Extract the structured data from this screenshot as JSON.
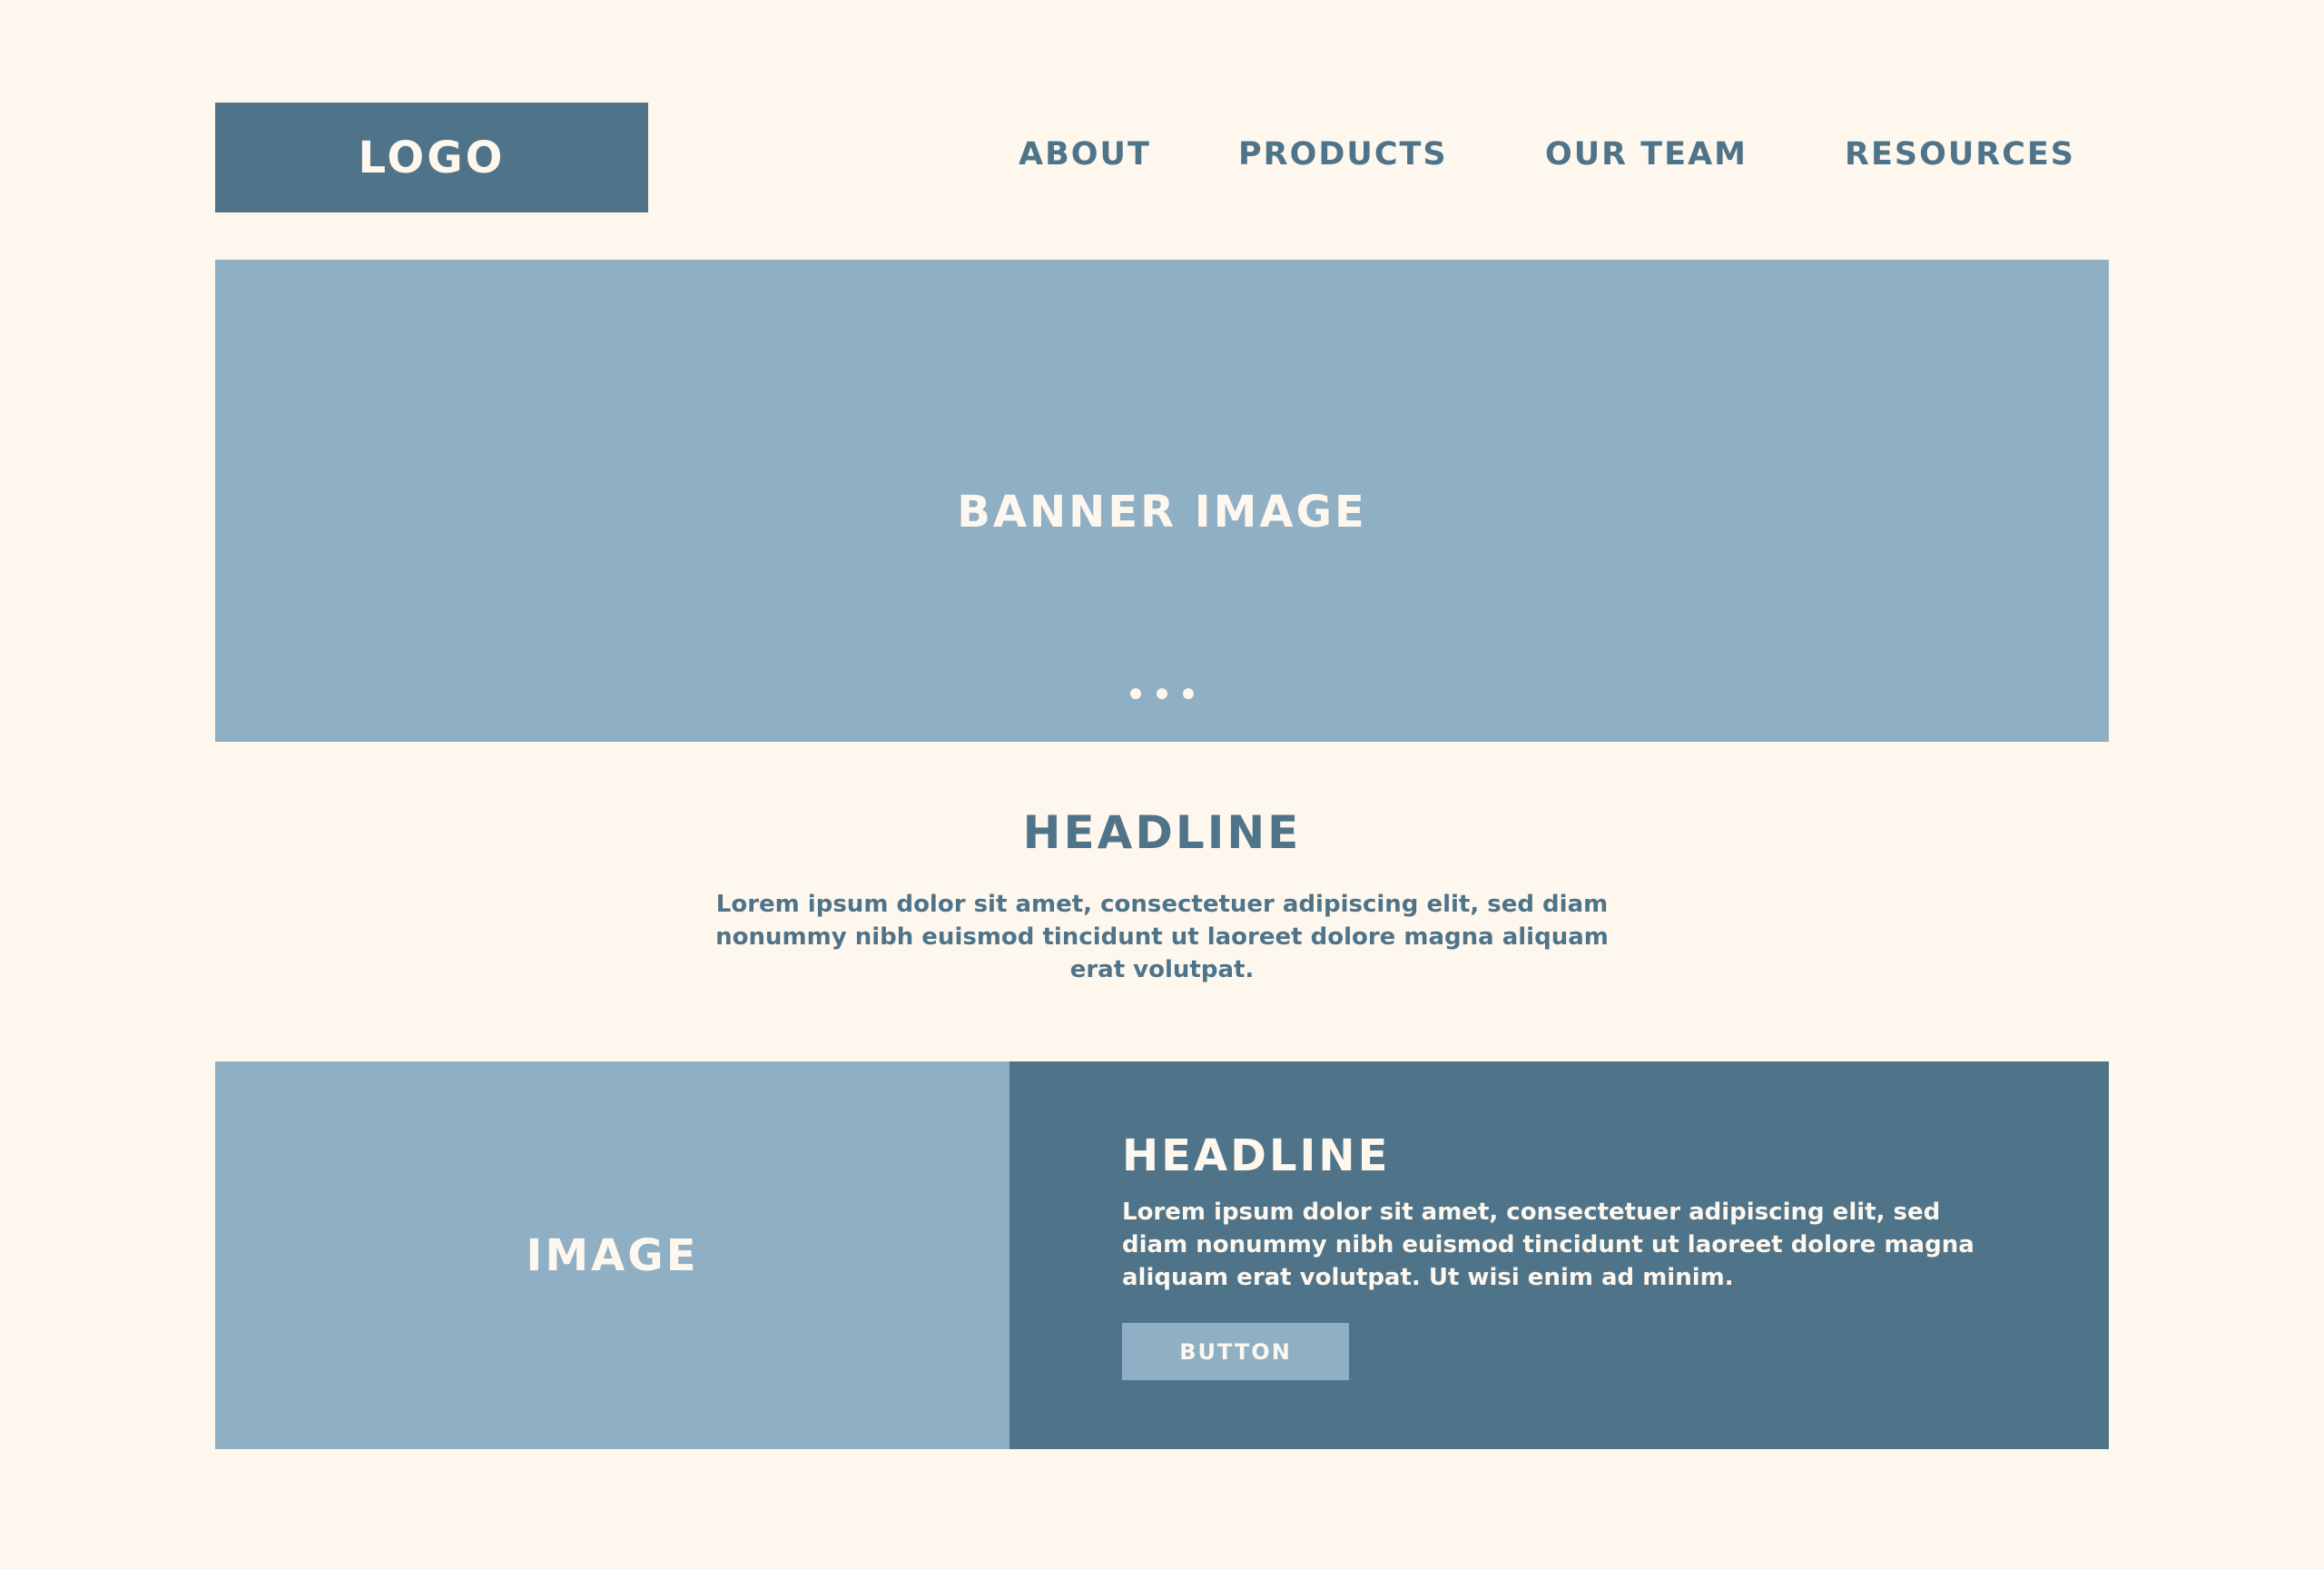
{
  "header": {
    "logo": "LOGO",
    "nav": [
      "ABOUT",
      "PRODUCTS",
      "OUR TEAM",
      "RESOURCES"
    ]
  },
  "banner": {
    "label": "BANNER IMAGE",
    "carousel_dots": 3
  },
  "intro": {
    "headline": "HEADLINE",
    "body": "Lorem ipsum dolor sit amet, consectetuer adipiscing elit, sed diam nonummy nibh euismod tincidunt ut laoreet dolore magna aliquam erat volutpat."
  },
  "feature": {
    "image_label": "IMAGE",
    "headline": "HEADLINE",
    "body": "Lorem ipsum dolor sit amet, consectetuer adipiscing elit, sed diam nonummy nibh euismod tincidunt ut laoreet dolore magna aliquam erat volutpat. Ut wisi enim ad minim.",
    "button_label": "BUTTON"
  },
  "colors": {
    "background": "#fef7ee",
    "primary": "#4f7489",
    "secondary": "#8fafc5"
  }
}
